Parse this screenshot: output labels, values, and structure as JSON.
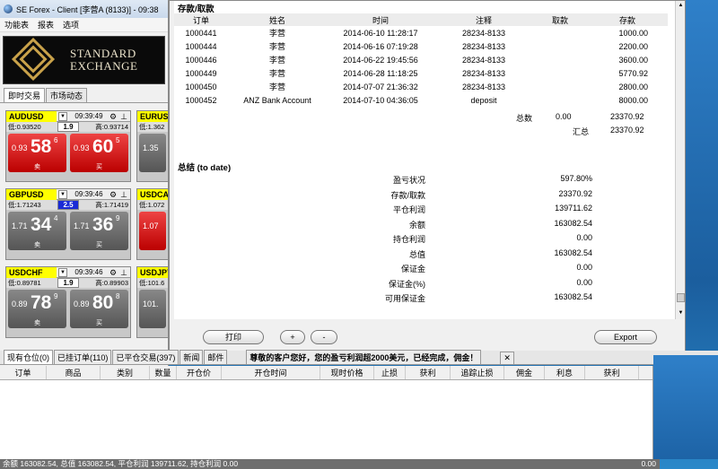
{
  "window": {
    "title": "SE Forex - Client [李营A (8133)] - 09:38"
  },
  "menu": [
    "功能表",
    "报表",
    "选项"
  ],
  "logo": {
    "line1": "STANDARD",
    "line2": "EXCHANGE"
  },
  "left_tabs": [
    "即时交易",
    "市场动态"
  ],
  "quotes": [
    {
      "symbol": "AUDUSD",
      "time": "09:39:49",
      "low": "低:0.93520",
      "spread": "1.9",
      "high": "高:0.93714",
      "sell": {
        "pre": "0.93",
        "big": "58",
        "sup": "6",
        "label": "卖"
      },
      "buy": {
        "pre": "0.93",
        "big": "60",
        "sup": "5",
        "label": "买"
      },
      "color": "red"
    },
    {
      "symbol": "GBPUSD",
      "time": "09:39:46",
      "low": "低:1.71243",
      "spread": "2.5",
      "high": "高:1.71419",
      "sell": {
        "pre": "1.71",
        "big": "34",
        "sup": "4",
        "label": "卖"
      },
      "buy": {
        "pre": "1.71",
        "big": "36",
        "sup": "9",
        "label": "买"
      },
      "color": "gray"
    },
    {
      "symbol": "USDCHF",
      "time": "09:39:46",
      "low": "低:0.89781",
      "spread": "1.9",
      "high": "高:0.89903",
      "sell": {
        "pre": "0.89",
        "big": "78",
        "sup": "9",
        "label": "卖"
      },
      "buy": {
        "pre": "0.89",
        "big": "80",
        "sup": "8",
        "label": "买"
      },
      "color": "gray"
    }
  ],
  "quotes_clipped": [
    {
      "symbol": "EURUS",
      "low": "低:1.362",
      "pre": "1.35",
      "color": "gray"
    },
    {
      "symbol": "USDCA",
      "low": "低:1.072",
      "pre": "1.07",
      "color": "red"
    },
    {
      "symbol": "USDJPY",
      "low": "低:101.6",
      "pre": "101.",
      "color": "gray"
    }
  ],
  "report": {
    "section_deposit": "存款/取款",
    "columns": [
      "订单",
      "姓名",
      "时间",
      "注释",
      "取款",
      "存款"
    ],
    "rows": [
      [
        "1000441",
        "李营",
        "2014-06-10 11:28:17",
        "28234-8133",
        "",
        "1000.00"
      ],
      [
        "1000444",
        "李营",
        "2014-06-16 07:19:28",
        "28234-8133",
        "",
        "2200.00"
      ],
      [
        "1000446",
        "李营",
        "2014-06-22 19:45:56",
        "28234-8133",
        "",
        "3600.00"
      ],
      [
        "1000449",
        "李营",
        "2014-06-28 11:18:25",
        "28234-8133",
        "",
        "5770.92"
      ],
      [
        "1000450",
        "李营",
        "2014-07-07 21:36:32",
        "28234-8133",
        "",
        "2800.00"
      ],
      [
        "1000452",
        "ANZ Bank Account",
        "2014-07-10 04:36:05",
        "deposit",
        "",
        "8000.00"
      ]
    ],
    "total_label": "总数",
    "total_withdraw": "0.00",
    "total_deposit": "23370.92",
    "sum_label": "汇总",
    "sum_value": "23370.92",
    "section_summary": "总结 (to date)",
    "summary": [
      {
        "k": "盈亏状况",
        "v": "597.80%"
      },
      {
        "k": "存款/取款",
        "v": "23370.92"
      },
      {
        "k": "平仓利润",
        "v": "139711.62"
      },
      {
        "k": "余额",
        "v": "163082.54"
      },
      {
        "k": "持仓利润",
        "v": "0.00"
      },
      {
        "k": "总值",
        "v": "163082.54"
      },
      {
        "k": "保证金",
        "v": "0.00"
      },
      {
        "k": "保证金(%)",
        "v": "0.00"
      },
      {
        "k": "可用保证金",
        "v": "163082.54"
      }
    ]
  },
  "dialog_buttons": {
    "print": "打印",
    "plus": "+",
    "minus": "-",
    "export": "Export"
  },
  "bottom_tabs": [
    "现有仓位(0)",
    "已挂订单(110)",
    "已平仓交易(397)",
    "新闻",
    "邮件"
  ],
  "ticker": "尊敬的客户您好，您的盈亏利润超2000美元，已经完成，佣金！",
  "grid_columns": [
    "订单",
    "商品",
    "类别",
    "数量",
    "开仓价",
    "开仓时间",
    "现时价格",
    "止损",
    "获利",
    "追踪止损",
    "佣金",
    "利息",
    "获利"
  ],
  "status": {
    "text": "余额 163082.54, 总值 163082.54, 平仓利润 139711.62, 持仓利润 0.00",
    "right": "0.00"
  }
}
